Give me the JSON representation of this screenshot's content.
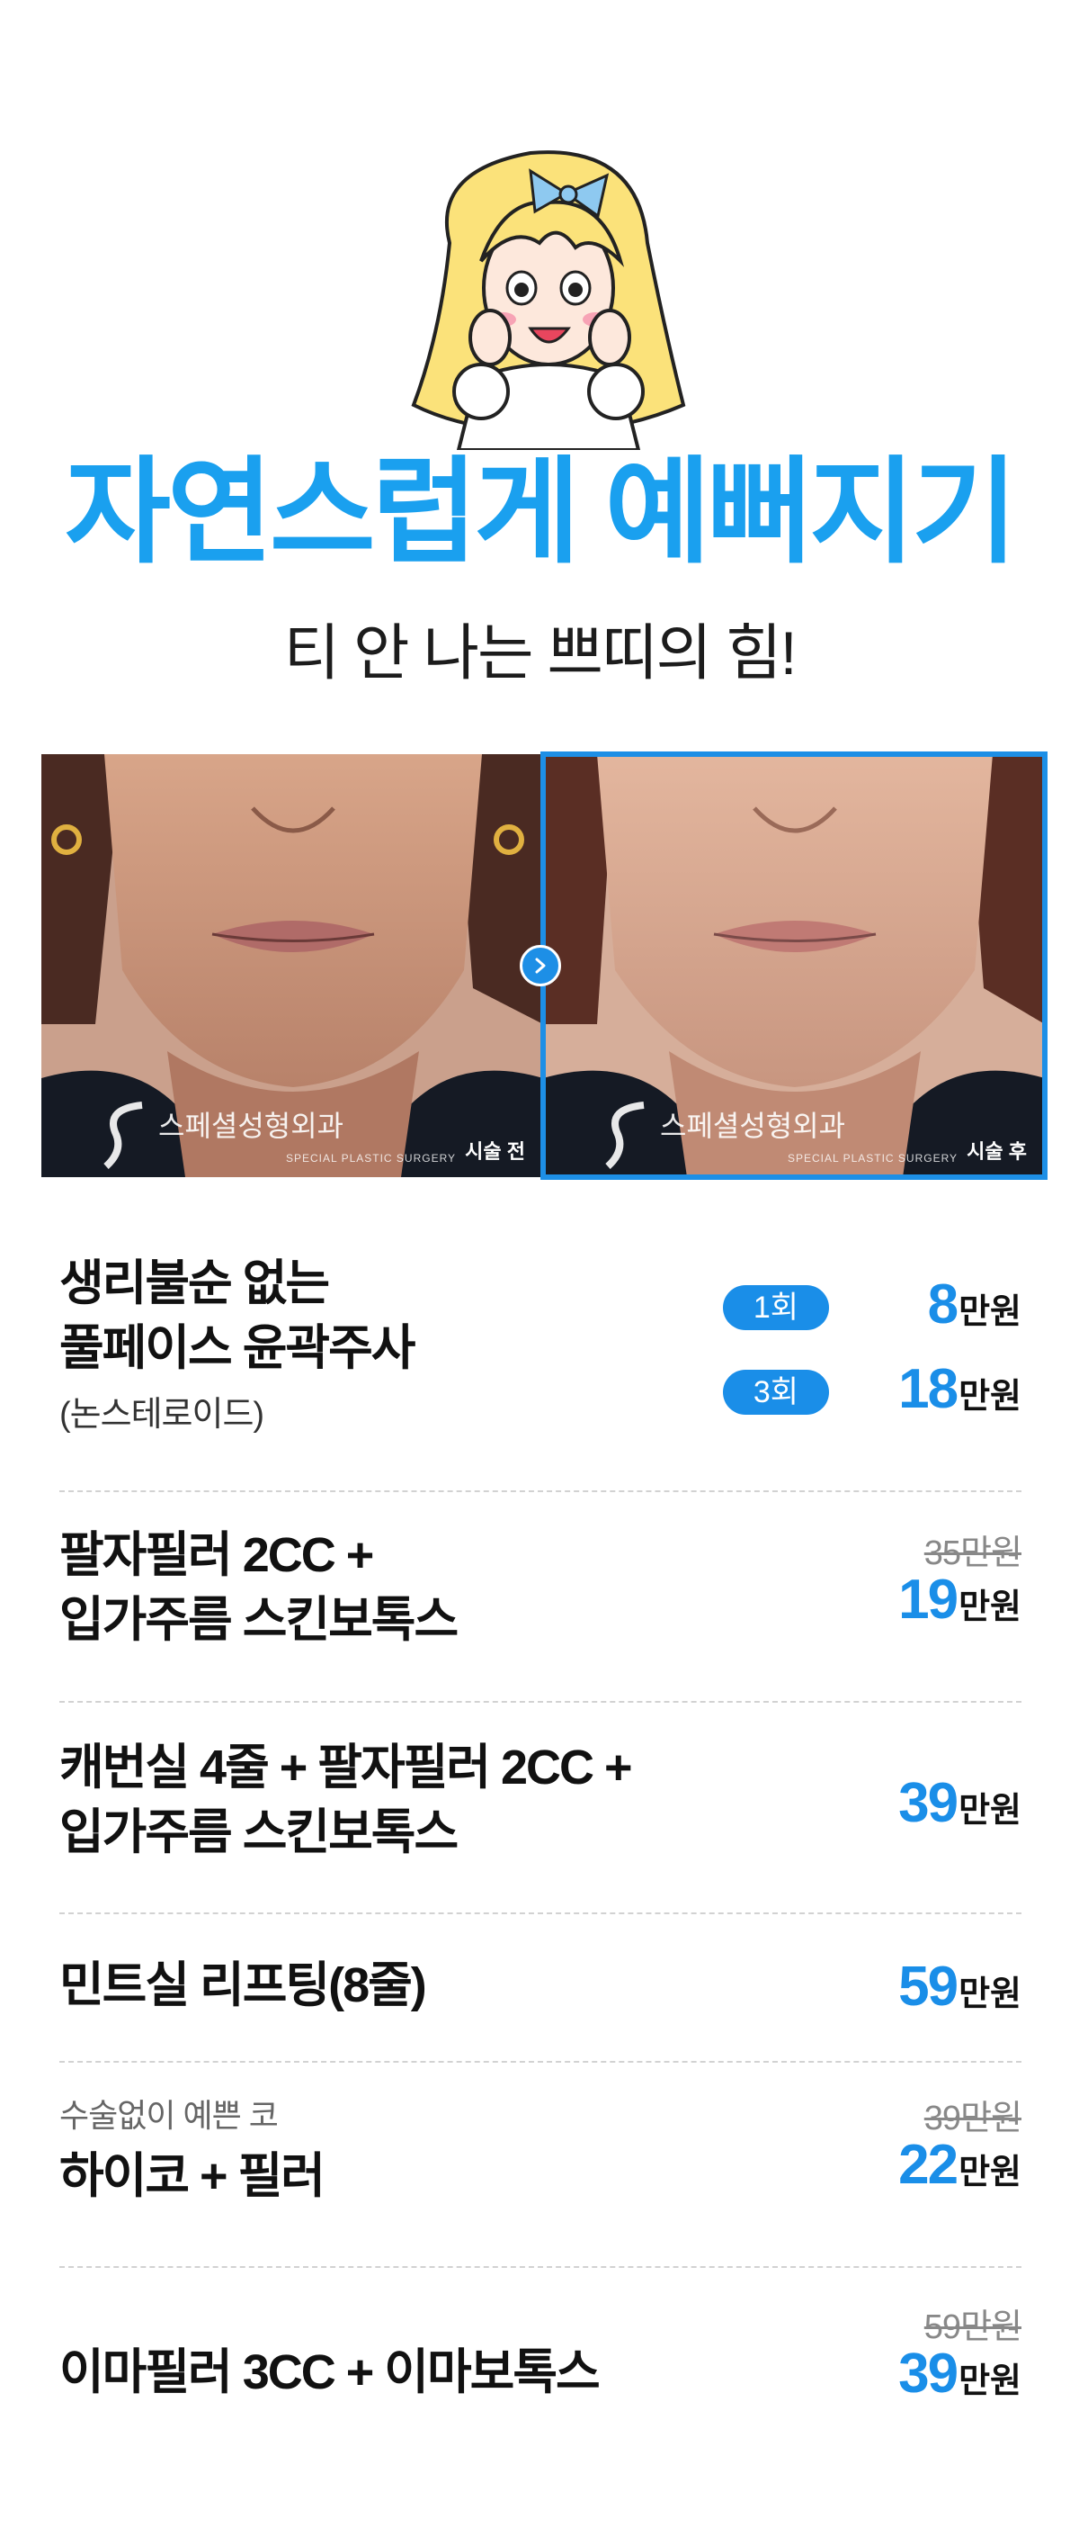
{
  "header": {
    "headline": "자연스럽게 예뻐지기",
    "subheadline": "티 안 나는 쁘띠의 힘!"
  },
  "comparison": {
    "before_label": "시술 전",
    "after_label": "시술 후",
    "watermark": "스페셜성형외과",
    "watermark_sub": "SPECIAL PLASTIC SURGERY"
  },
  "price_unit": "만원",
  "items": [
    {
      "name_line1": "생리불순 없는",
      "name_line2": "풀페이스 윤곽주사",
      "note": "(논스테로이드)",
      "options": [
        {
          "label": "1회",
          "price": "8"
        },
        {
          "label": "3회",
          "price": "18"
        }
      ]
    },
    {
      "name_line1": "팔자필러 2CC +",
      "name_line2": "입가주름 스킨보톡스",
      "original_price": "35만원",
      "price": "19"
    },
    {
      "name_line1": "캐번실 4줄 + 팔자필러 2CC +",
      "name_line2": "입가주름 스킨보톡스",
      "price": "39"
    },
    {
      "name_line1": "민트실 리프팅(8줄)",
      "price": "59"
    },
    {
      "caption": "수술없이 예쁜 코",
      "name_line1": "하이코 + 필러",
      "original_price": "39만원",
      "price": "22"
    },
    {
      "name_line1": "이마필러 3CC + 이마보톡스",
      "original_price": "59만원",
      "price": "39"
    }
  ],
  "colors": {
    "accent_blue": "#1a8ee8",
    "headline_blue": "#1aa0ef"
  }
}
